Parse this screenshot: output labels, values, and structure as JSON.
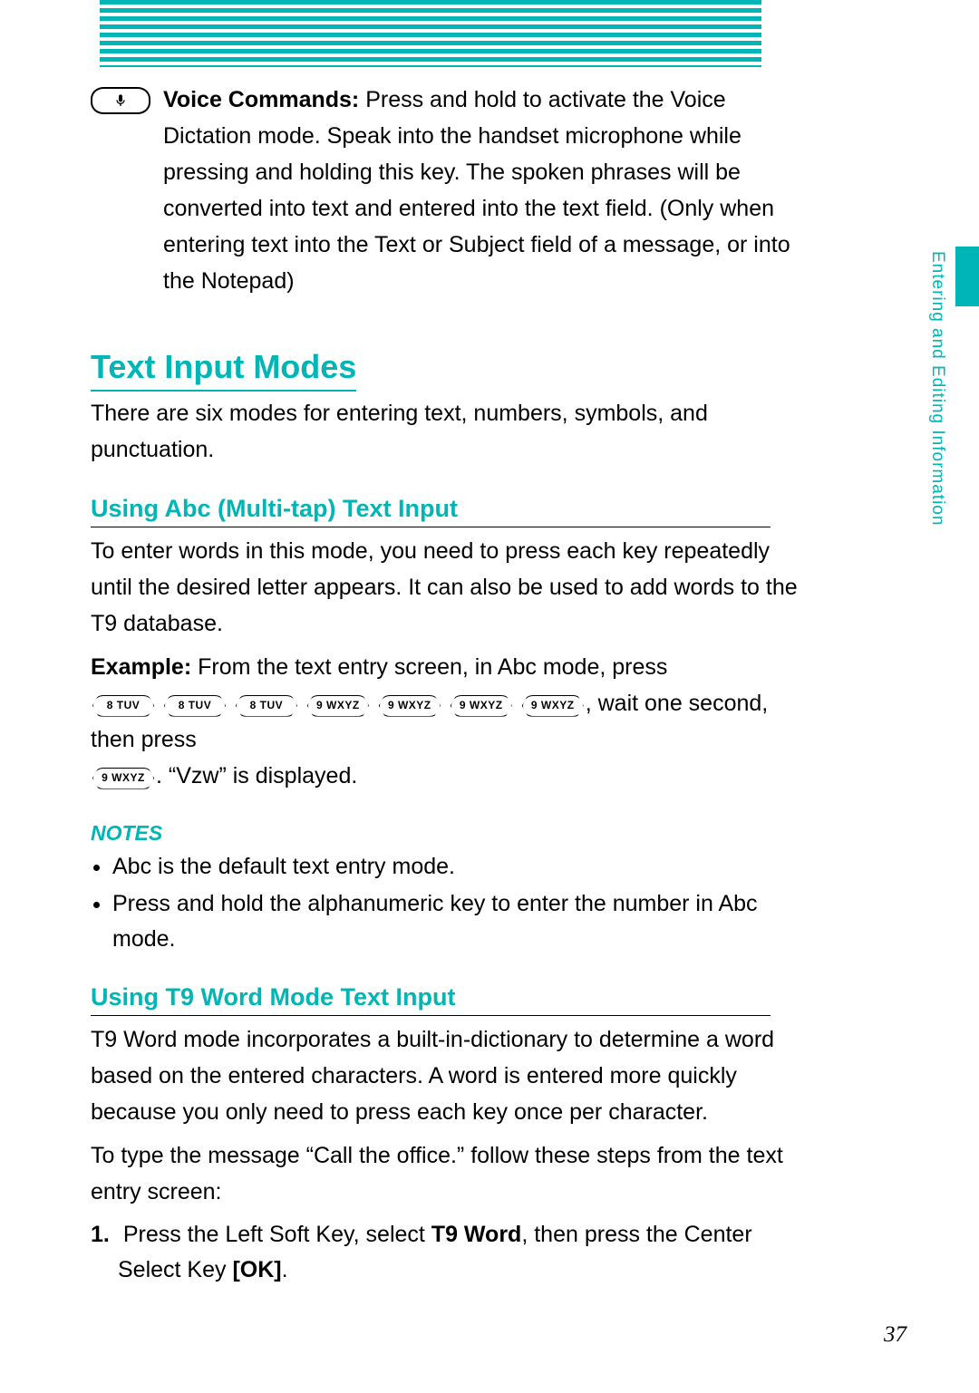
{
  "side_tab_label": "Entering and Editing Information",
  "voice_commands": {
    "label": "Voice Commands:",
    "text": " Press and hold to activate the Voice Dictation mode. Speak into the handset microphone while pressing and holding this key. The spoken phrases will be converted into text and entered into the text field. (Only when entering text into the Text or Subject field of a message, or into the Notepad)"
  },
  "section_heading": "Text Input Modes",
  "section_intro": "There are six modes for entering text, numbers, symbols, and punctuation.",
  "abc": {
    "heading": "Using Abc (Multi-tap) Text Input",
    "para": "To enter words in this mode, you need to press each key repeatedly until the desired letter appears. It can also be used to add words to the T9 database.",
    "example_label": "Example:",
    "example_lead": " From the text entry screen, in Abc mode, press",
    "example_tail_1": ", wait one second, then press ",
    "example_tail_2": ". “Vzw” is displayed."
  },
  "keys": {
    "k8": "8 TUV",
    "k9": "9 WXYZ"
  },
  "notes": {
    "label": "NOTES",
    "items": [
      "Abc is the default text entry mode.",
      "Press and hold the alphanumeric key to enter the number in Abc mode."
    ]
  },
  "t9": {
    "heading": "Using T9 Word Mode Text Input",
    "para1": "T9 Word mode incorporates a built-in-dictionary to determine a word based on the entered characters. A word is entered more quickly because you only need to press each key once per character.",
    "para2": "To type the message “Call the office.” follow these steps from the text entry screen:",
    "step1_pre": "Press the Left Soft Key, select ",
    "step1_bold1": "T9 Word",
    "step1_mid": ", then press the Center Select Key ",
    "step1_bold2": "[OK]",
    "step1_post": "."
  },
  "page_number": "37"
}
